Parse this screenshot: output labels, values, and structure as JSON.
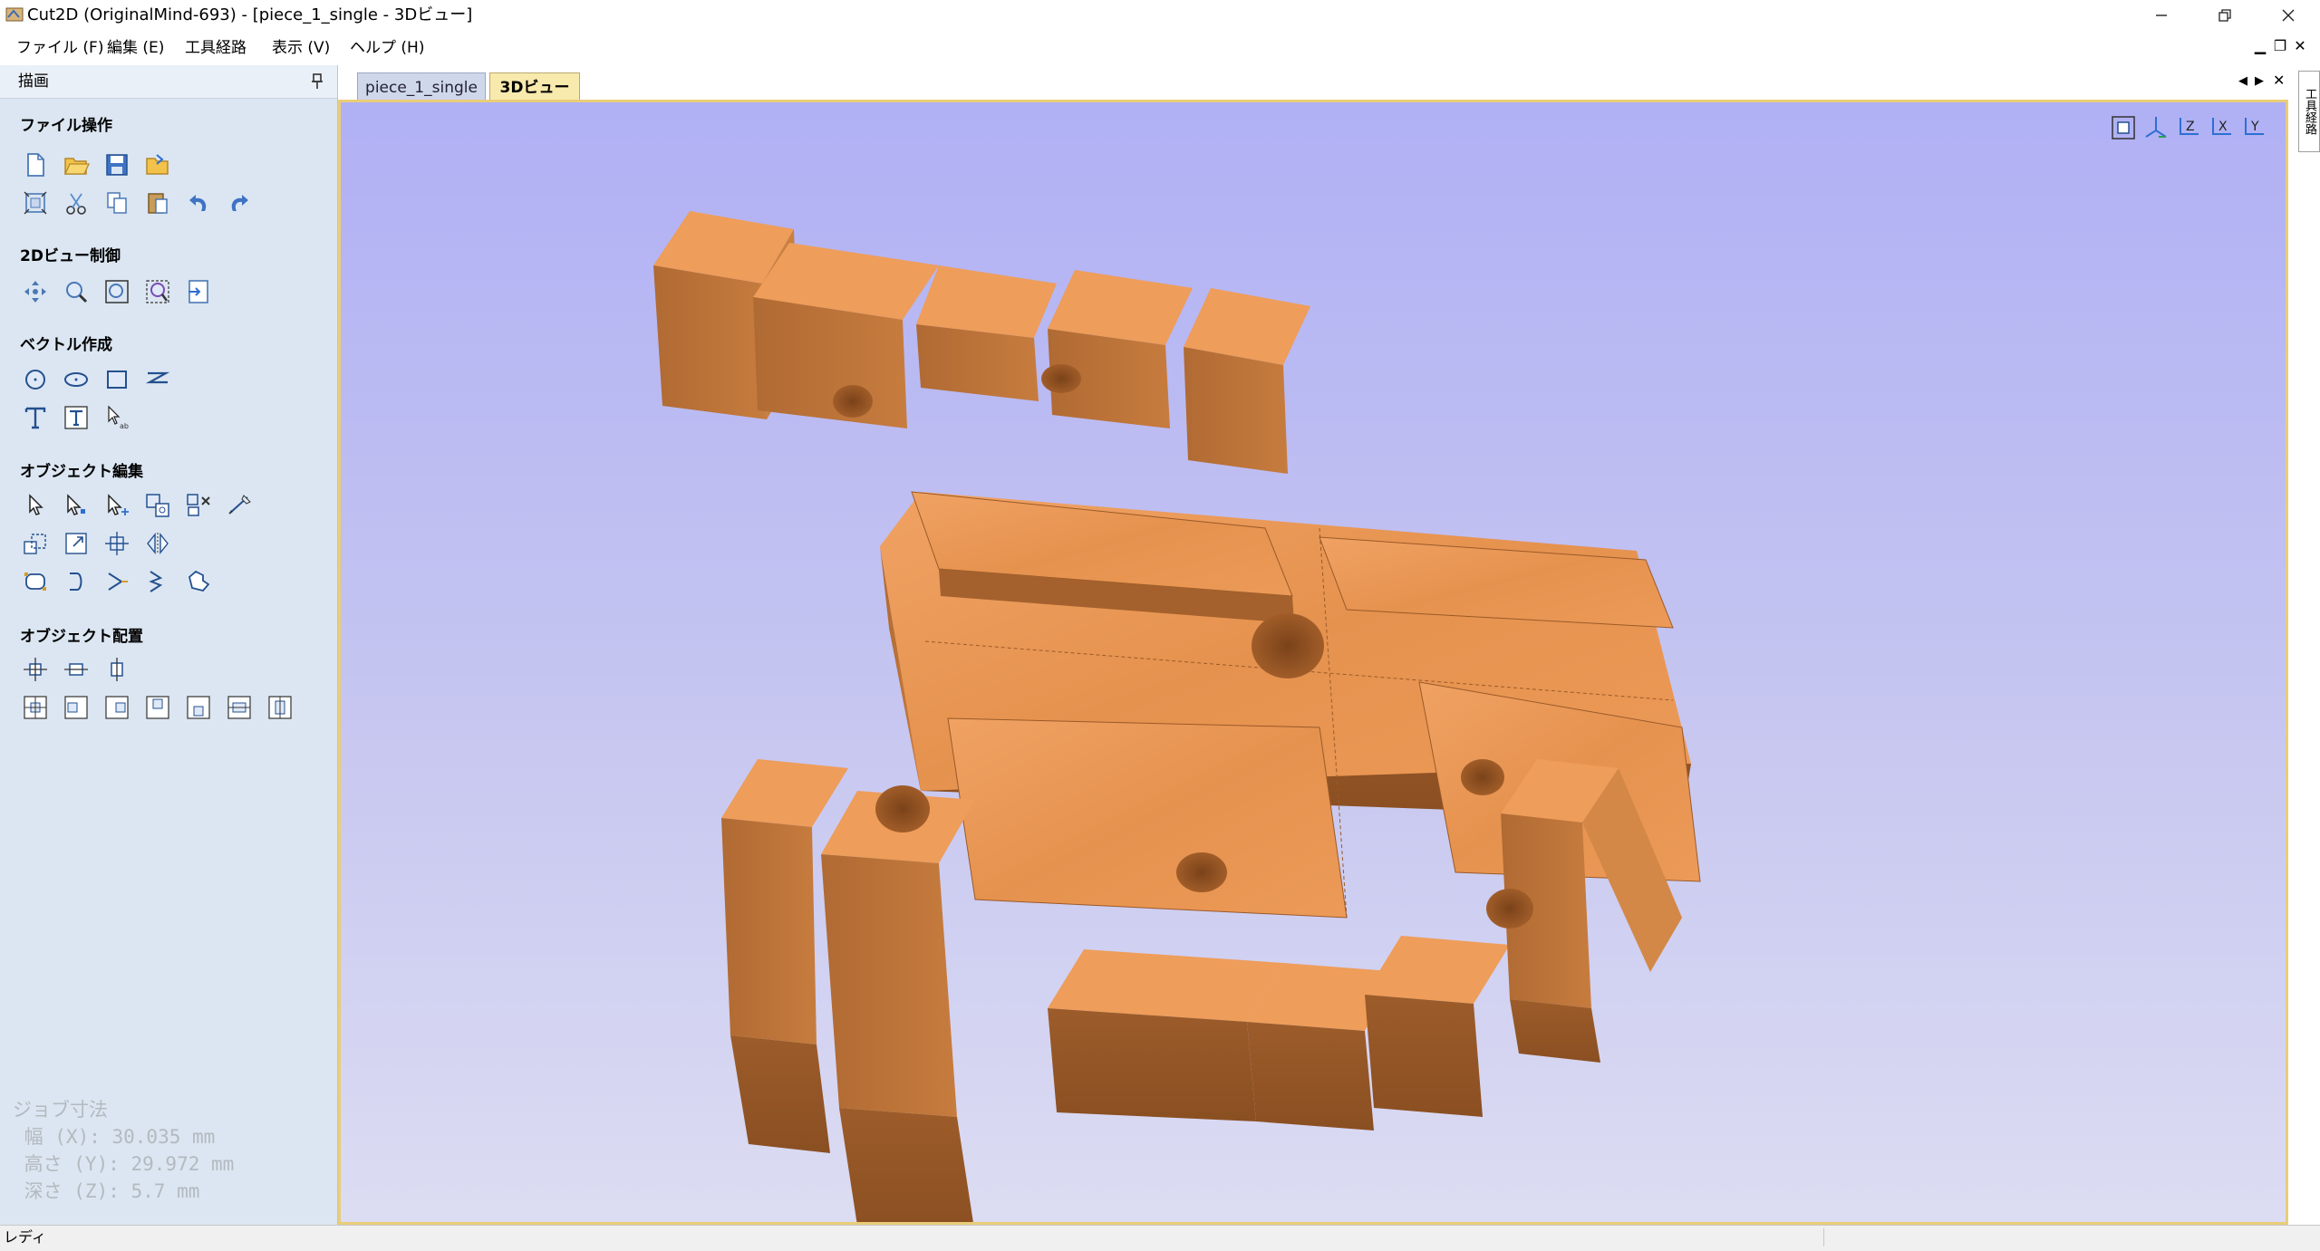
{
  "window": {
    "title": "Cut2D (OriginalMind-693) - [piece_1_single - 3Dビュー]",
    "controls": [
      "minimize-icon",
      "restore-icon",
      "close-icon"
    ]
  },
  "menu": {
    "items": [
      "ファイル (F)",
      "編集 (E)",
      "工具経路",
      "表示 (V)",
      "ヘルプ (H)"
    ]
  },
  "panel": {
    "title": "描画",
    "groups": [
      {
        "label": "ファイル操作",
        "icons": [
          "new-file-icon",
          "open-folder-icon",
          "save-icon",
          "import-icon",
          "fit-to-material-icon",
          "cut-icon",
          "copy-icon",
          "paste-icon",
          "undo-icon",
          "redo-icon"
        ]
      },
      {
        "label": "2Dビュー制御",
        "icons": [
          "pan-icon",
          "zoom-box-icon",
          "zoom-fit-icon",
          "zoom-selection-icon",
          "toggle-view-icon"
        ]
      },
      {
        "label": "ベクトル作成",
        "icons": [
          "circle-icon",
          "ellipse-icon",
          "rectangle-icon",
          "polyline-icon",
          "text-icon",
          "text-box-icon",
          "dimension-icon"
        ]
      },
      {
        "label": "オブジェクト編集",
        "icons": [
          "select-icon",
          "node-edit-icon",
          "interactive-edit-icon",
          "group-icon",
          "ungroup-icon",
          "measure-icon",
          "scale-icon",
          "transform-icon",
          "move-icon",
          "mirror-icon",
          "weld-icon",
          "trim-icon",
          "extend-icon",
          "fillet-icon",
          "offset-icon"
        ]
      },
      {
        "label": "オブジェクト配置",
        "icons": [
          "center-icon",
          "center-horizontal-icon",
          "center-vertical-icon",
          "align-center-icon",
          "align-left-icon",
          "align-right-icon",
          "align-top-icon",
          "align-bottom-icon",
          "distribute-horizontal-icon",
          "distribute-vertical-icon"
        ]
      }
    ],
    "job": {
      "heading": "ジョブ寸法",
      "width": " 幅 (X): 30.035 mm",
      "height": " 高さ (Y): 29.972 mm",
      "depth": " 深さ (Z): 5.7 mm"
    }
  },
  "tabs": [
    {
      "label": "piece_1_single",
      "active": false
    },
    {
      "label": "3Dビュー",
      "active": true
    }
  ],
  "view_buttons": [
    "fit-view-icon",
    "axis-iso-icon",
    "axis-z-icon",
    "axis-x-icon",
    "axis-y-icon"
  ],
  "right_tab": "工具経路",
  "status": {
    "text": "レディ"
  },
  "colors": {
    "viewport_top": "#b0b0f5",
    "viewport_bottom": "#dcdcf2",
    "wood": "#e89555",
    "panel": "#dbe6f2",
    "active_tab": "#f8e9ad"
  }
}
